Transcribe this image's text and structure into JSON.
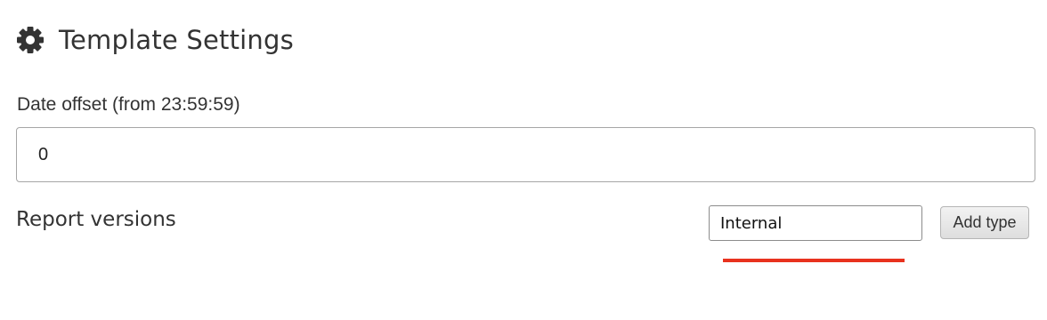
{
  "header": {
    "icon": "gear-icon",
    "title": "Template Settings"
  },
  "date_offset": {
    "label": "Date offset (from 23:59:59)",
    "value": "0"
  },
  "report_versions": {
    "label": "Report versions",
    "type_input_value": "Internal",
    "add_button_label": "Add type"
  },
  "colors": {
    "text": "#333333",
    "border": "#a6a6a6",
    "error_underline": "#e8321e",
    "button_bg": "#e6e6e6"
  }
}
